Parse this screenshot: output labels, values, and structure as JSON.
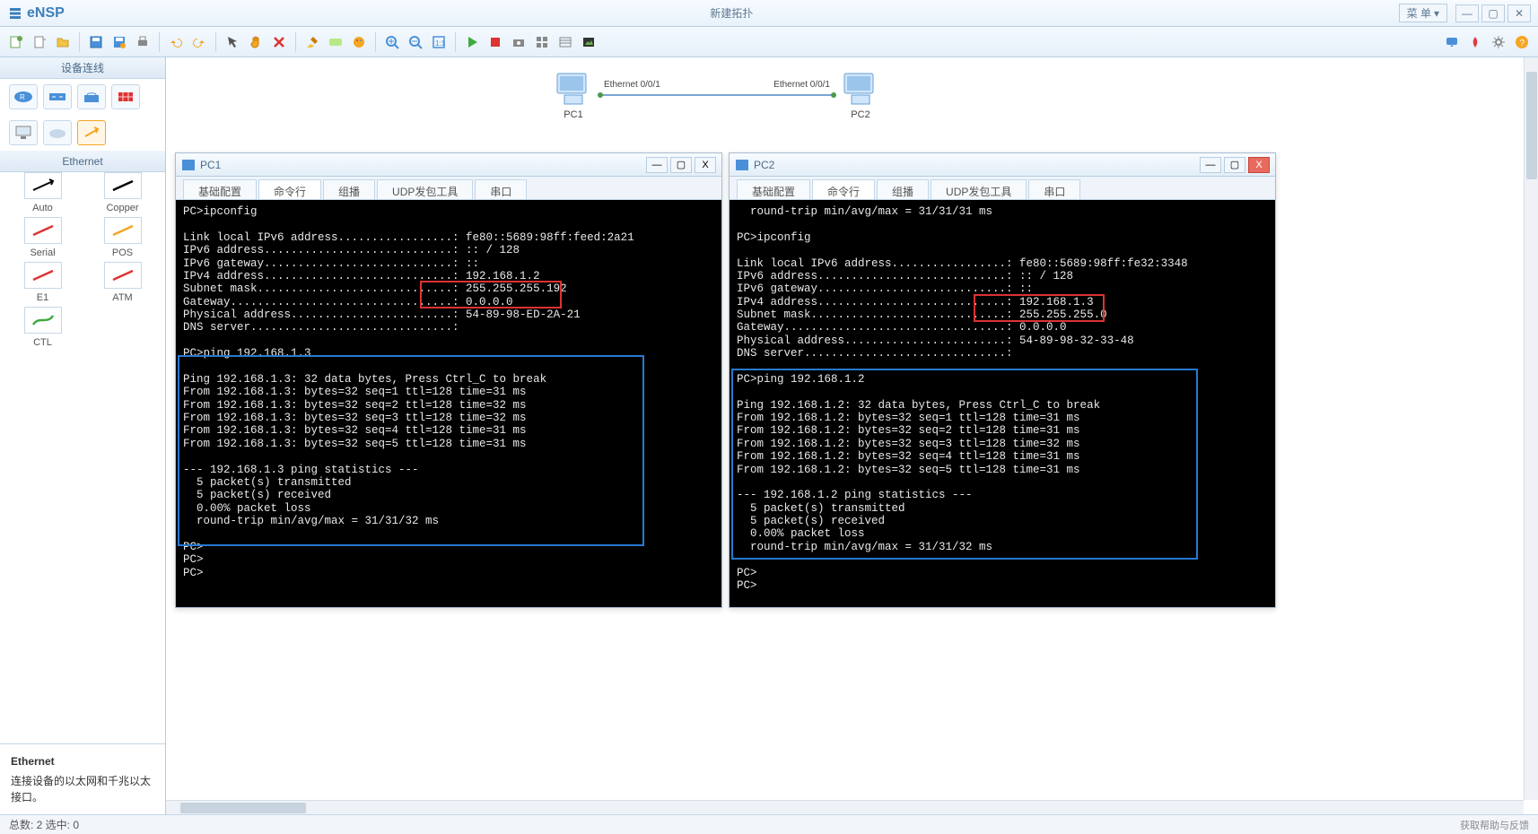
{
  "app": {
    "name": "eNSP",
    "window_title": "新建拓扑",
    "menu_label": "菜 单"
  },
  "sidebar": {
    "devices_title": "设备连线",
    "ethernet_title": "Ethernet",
    "cables": [
      {
        "name": "Auto"
      },
      {
        "name": "Copper"
      },
      {
        "name": "Serial"
      },
      {
        "name": "POS"
      },
      {
        "name": "E1"
      },
      {
        "name": "ATM"
      },
      {
        "name": "CTL"
      }
    ],
    "desc_title": "Ethernet",
    "desc_body": "连接设备的以太网和千兆以太接口。"
  },
  "topology": {
    "pc1": "PC1",
    "pc2": "PC2",
    "link_left": "Ethernet 0/0/1",
    "link_right": "Ethernet 0/0/1"
  },
  "common_tabs": [
    "基础配置",
    "命令行",
    "组播",
    "UDP发包工具",
    "串口"
  ],
  "active_tab_index": 1,
  "pc1": {
    "title": "PC1",
    "ipconfig": {
      "prompt": "PC>ipconfig",
      "link_local": "fe80::5689:98ff:feed:2a21",
      "ipv6_addr": ":: / 128",
      "ipv6_gw": "::",
      "ipv4_addr": "192.168.1.2",
      "subnet": "255.255.255.192",
      "gateway": "0.0.0.0",
      "mac": "54-89-98-ED-2A-21",
      "dns": ""
    },
    "ping": {
      "cmd": "PC>ping 192.168.1.3",
      "target": "192.168.1.3",
      "header": "Ping 192.168.1.3: 32 data bytes, Press Ctrl_C to break",
      "replies": [
        "From 192.168.1.3: bytes=32 seq=1 ttl=128 time=31 ms",
        "From 192.168.1.3: bytes=32 seq=2 ttl=128 time=32 ms",
        "From 192.168.1.3: bytes=32 seq=3 ttl=128 time=32 ms",
        "From 192.168.1.3: bytes=32 seq=4 ttl=128 time=31 ms",
        "From 192.168.1.3: bytes=32 seq=5 ttl=128 time=31 ms"
      ],
      "stats_header": "--- 192.168.1.3 ping statistics ---",
      "stats": [
        "  5 packet(s) transmitted",
        "  5 packet(s) received",
        "  0.00% packet loss",
        "  round-trip min/avg/max = 31/31/32 ms"
      ]
    },
    "trailing": [
      "PC>",
      "PC>",
      "PC>"
    ]
  },
  "pc2": {
    "title": "PC2",
    "preline": "  round-trip min/avg/max = 31/31/31 ms",
    "ipconfig": {
      "prompt": "PC>ipconfig",
      "link_local": "fe80::5689:98ff:fe32:3348",
      "ipv6_addr": ":: / 128",
      "ipv6_gw": "::",
      "ipv4_addr": "192.168.1.3",
      "subnet": "255.255.255.0",
      "gateway": "0.0.0.0",
      "mac": "54-89-98-32-33-48",
      "dns": ""
    },
    "ping": {
      "cmd": "PC>ping 192.168.1.2",
      "target": "192.168.1.2",
      "header": "Ping 192.168.1.2: 32 data bytes, Press Ctrl_C to break",
      "replies": [
        "From 192.168.1.2: bytes=32 seq=1 ttl=128 time=31 ms",
        "From 192.168.1.2: bytes=32 seq=2 ttl=128 time=31 ms",
        "From 192.168.1.2: bytes=32 seq=3 ttl=128 time=32 ms",
        "From 192.168.1.2: bytes=32 seq=4 ttl=128 time=31 ms",
        "From 192.168.1.2: bytes=32 seq=5 ttl=128 time=31 ms"
      ],
      "stats_header": "--- 192.168.1.2 ping statistics ---",
      "stats": [
        "  5 packet(s) transmitted",
        "  5 packet(s) received",
        "  0.00% packet loss",
        "  round-trip min/avg/max = 31/31/32 ms"
      ]
    },
    "trailing": [
      "PC>",
      "PC>"
    ]
  },
  "status": {
    "left": "总数: 2 选中: 0",
    "right": "获取帮助与反馈"
  },
  "colors": {
    "accent": "#3e7fbb",
    "highlight_red": "#d33",
    "highlight_blue": "#2a78d0"
  }
}
